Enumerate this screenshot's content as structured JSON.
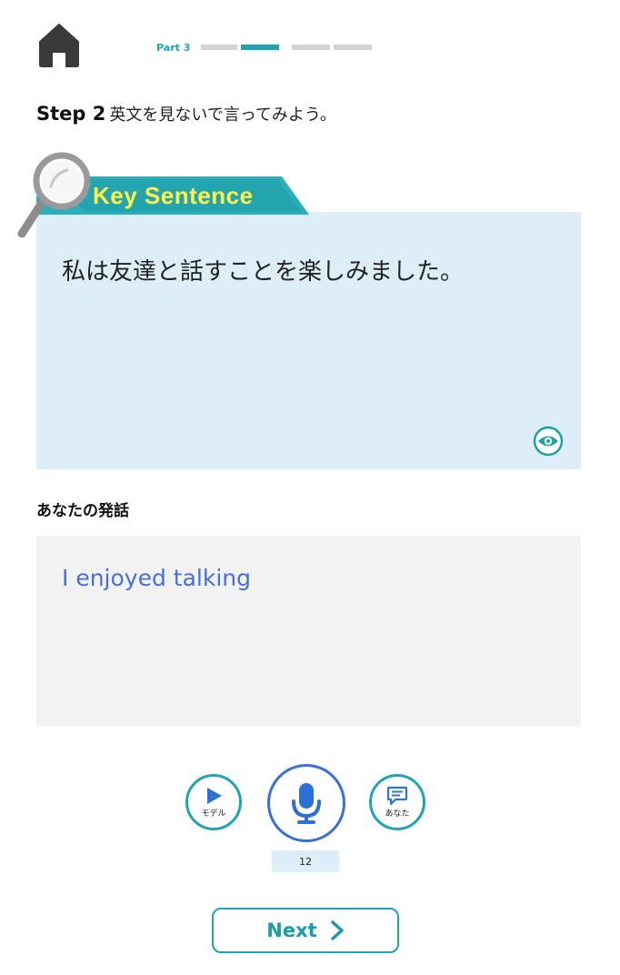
{
  "header": {
    "home_icon": "home-icon",
    "progress": {
      "label": "Part 3",
      "segments": 4,
      "active_segment": 2,
      "active_color": "#1fa4b4",
      "inactive_color": "#d3d3d3"
    }
  },
  "step": {
    "label": "Step 2",
    "instruction": "英文を見ないで言ってみよう。"
  },
  "key_sentence": {
    "tab_label": "Key Sentence",
    "tab_icon": "magnifier-icon",
    "text": "私は友達と話すことを楽しみました。",
    "reveal_icon": "eye-icon",
    "bg_color": "#ddeef9"
  },
  "speech": {
    "label": "あなたの発話",
    "text": "I enjoyed talking",
    "text_color": "#4a6fd6"
  },
  "controls": {
    "model_label": "モデル",
    "model_icon": "play-icon",
    "mic_icon": "microphone-icon",
    "you_label": "あなた",
    "you_icon": "speech-bubble-icon",
    "counter": "12"
  },
  "footer": {
    "next_label": "Next",
    "next_icon": "chevron-right-icon"
  }
}
